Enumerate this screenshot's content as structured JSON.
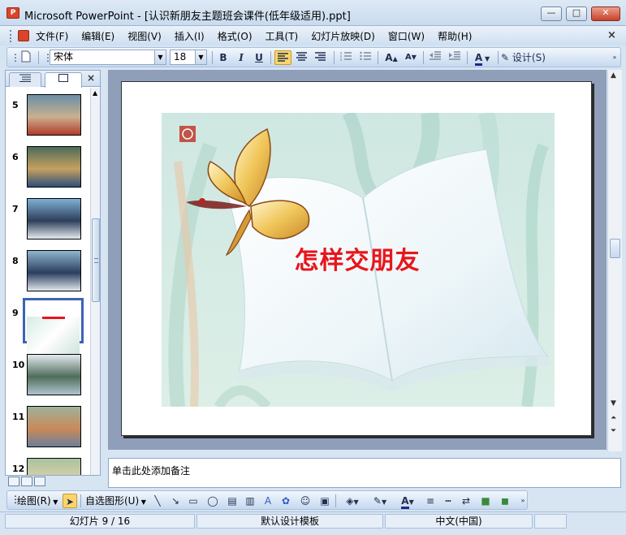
{
  "window": {
    "title": "Microsoft PowerPoint - [认识新朋友主题班会课件(低年级适用).ppt]",
    "min_symbol": "—",
    "max_symbol": "□",
    "close_symbol": "✕",
    "app_icon": "P"
  },
  "menu": {
    "items": [
      "文件(F)",
      "编辑(E)",
      "视图(V)",
      "插入(I)",
      "格式(O)",
      "工具(T)",
      "幻灯片放映(D)",
      "窗口(W)",
      "帮助(H)"
    ],
    "close_symbol": "×"
  },
  "toolbar": {
    "font_name": "宋体",
    "font_size": "18",
    "bold": "B",
    "italic": "I",
    "underline": "U",
    "design_label": "设计(S)"
  },
  "left_pane": {
    "close_symbol": "×",
    "thumbnails": [
      {
        "number": "5"
      },
      {
        "number": "6"
      },
      {
        "number": "7"
      },
      {
        "number": "8"
      },
      {
        "number": "9",
        "selected": true
      },
      {
        "number": "10"
      },
      {
        "number": "11"
      },
      {
        "number": "12"
      }
    ]
  },
  "slide": {
    "title": "怎样交朋友"
  },
  "notes": {
    "placeholder": "单击此处添加备注"
  },
  "draw_toolbar": {
    "draw_label": "绘图(R)",
    "autoshape_label": "自选图形(U)"
  },
  "status": {
    "slide_position": "幻灯片 9 / 16",
    "template": "默认设计模板",
    "language": "中文(中国)"
  },
  "colors": {
    "title_red": "#e8151b",
    "selection_blue": "#3c64b4",
    "chrome_blue": "#cfdff0"
  }
}
